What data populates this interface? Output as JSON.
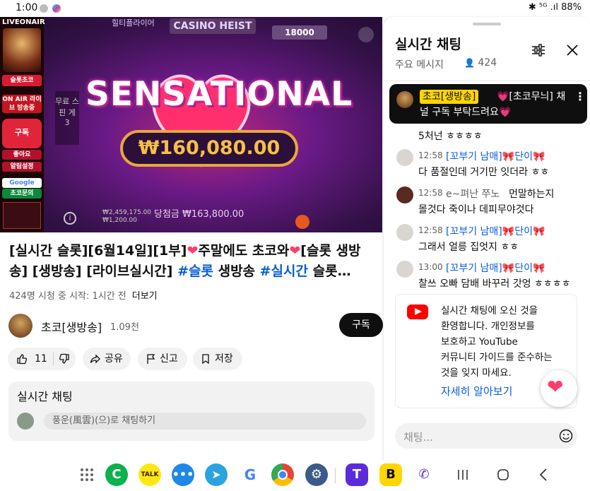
{
  "status_bar": {
    "time": "1:00",
    "right": "⁵ᴳ .ıl 88%",
    "battery": "88%"
  },
  "video": {
    "overlay_live": "LIVEONAIR",
    "strip_labels": [
      "슬롯초코",
      "ON AIR 라이브 방송중",
      "구독",
      "좋아요",
      "알림설정",
      "Google",
      "초코문의"
    ],
    "banner_small": "힐티플라이어",
    "banner_casino": "CASINO HEIST",
    "banner_number": "18000",
    "slot_side_label": "무료 스핀 게 3",
    "big_word": "SENSATIONAL",
    "win_amount": "₩160,080.00",
    "small_values": "₩2,459,175.00\n₩1,200.00",
    "win_line": "당첨금 ₩163,800.00"
  },
  "title": {
    "part1": "[실시간 슬롯][6월14일][1부]",
    "part2": "주말에도 초코와",
    "part3": "[슬롯 생방송] [생방송] [라이브실시간] ",
    "hash1": "#슬롯",
    "part4": " 생방송 ",
    "hash2": "#실시간",
    "part5": " 슬롯…"
  },
  "meta": {
    "views": "424명 시청 중  시작: 1시간 전",
    "more": "더보기"
  },
  "channel": {
    "name": "초코[생방송]",
    "subs": "1.09천",
    "subscribe": "구독"
  },
  "actions": {
    "likes": "11",
    "share": "공유",
    "report": "신고",
    "save": "저장"
  },
  "chat_box": {
    "title": "실시간 채팅",
    "placeholder": "풍운(風雲)(으)로 채팅하기"
  },
  "panel": {
    "title": "실시간 채팅",
    "mode": "주요 메시지",
    "viewers": "424",
    "pinned": {
      "badge": "초코[생방송]",
      "line1": "💗[초코무늬] 채",
      "line2": "널 구독 부탁드려요💗"
    },
    "messages": [
      {
        "time": "",
        "author": "",
        "text": "5처넌 ㅎㅎㅎㅎ"
      },
      {
        "time": "12:58",
        "author": "[꼬부기 남매]🎀단이🎀",
        "text": "다 품절인데 거기만 잇더라 ㅎㅎ"
      },
      {
        "time": "12:58",
        "author": "e~펴난 쭈노",
        "text": "먼말하는지",
        "text2": "몰것다 죽이나 데피무야것다"
      },
      {
        "time": "12:58",
        "author": "[꼬부기 남매]🎀단이🎀",
        "text": "그래서 얼릉 집엇지 ㅎㅎ"
      },
      {
        "time": "13:00",
        "author": "[꼬부기 남매]🎀단이🎀",
        "text": "찰쓰 오빠 담배 바꾸러 갓엉 ㅎㅎㅎㅎ"
      }
    ],
    "welcome_lines": [
      "실시간 채팅에 오신 것을",
      "환영합니다. 개인정보를",
      "보호하고 YouTube",
      "커뮤니티 가이드를 준수하는",
      "것을 잊지 마세요."
    ],
    "welcome_link": "자세히 알아보기",
    "input_placeholder": "채팅..."
  },
  "nav": {
    "kakao_talk": "TALK",
    "google": "G",
    "t_app": "T",
    "b_app": "B"
  },
  "colors": {
    "link_blue": "#065fd4",
    "badge_yellow": "#ffd600",
    "youtube_red": "#ff0000",
    "heart": "#ff3d6a"
  }
}
